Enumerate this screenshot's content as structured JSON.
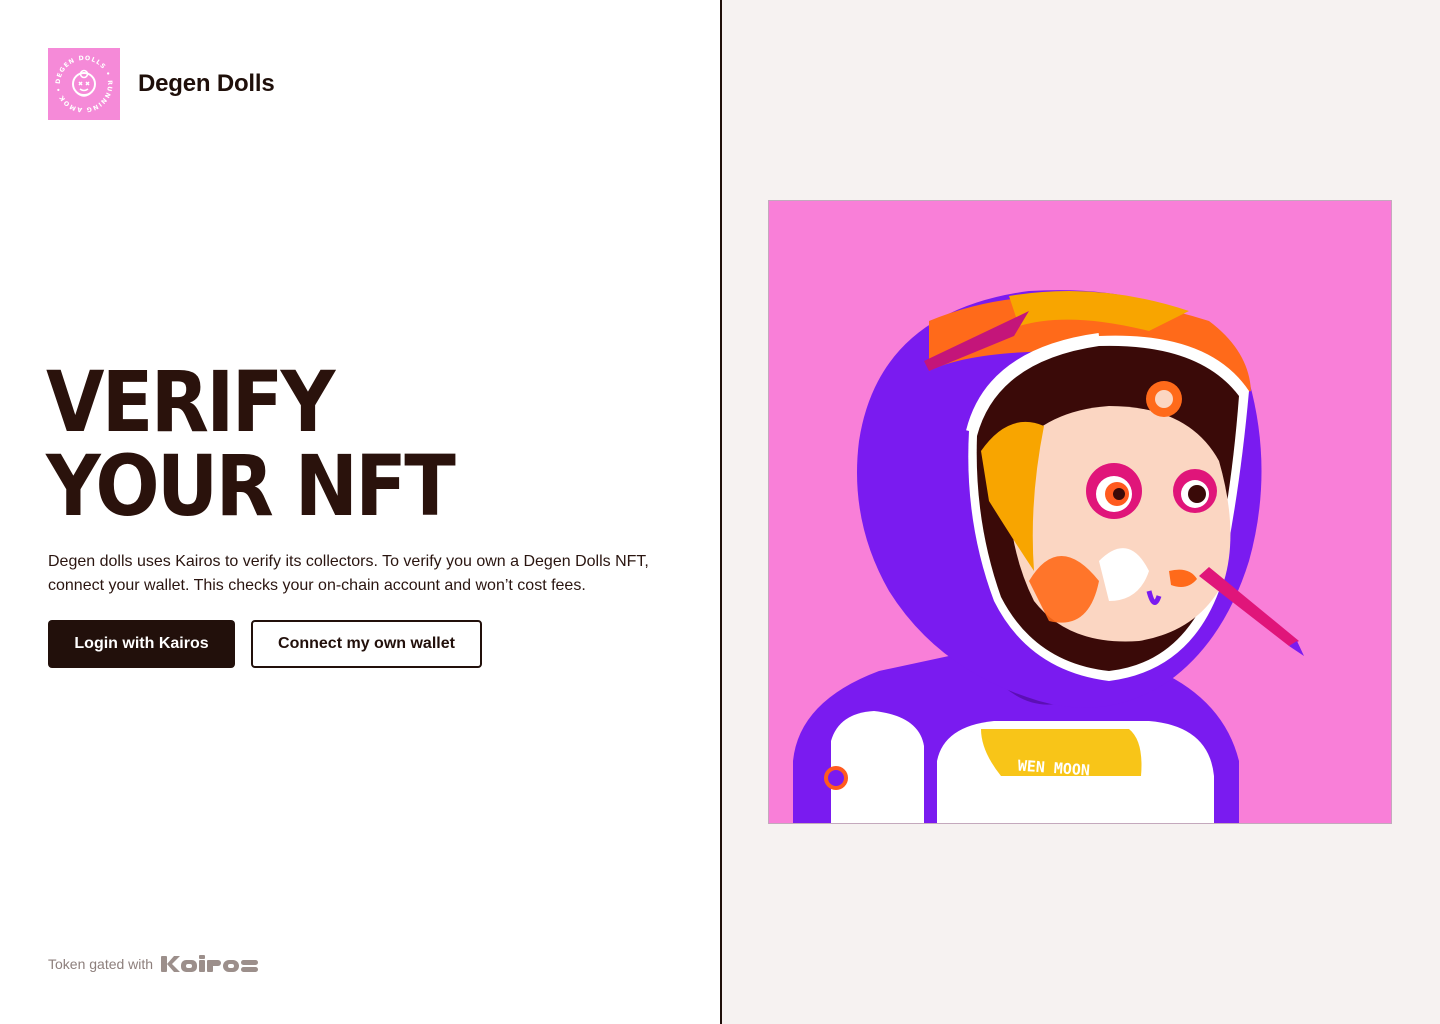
{
  "brand": {
    "name": "Degen Dolls",
    "logo_icon": "degen-dolls-badge",
    "logo_ring_text": "DEGEN DOLLS • RUNNING AMOK •",
    "logo_bg": "#f58ad8"
  },
  "hero": {
    "headline_line1": "VERIFY",
    "headline_line2": "YOUR NFT",
    "description": "Degen dolls uses Kairos to verify its collectors. To verify you own a Degen Dolls NFT, connect your wallet. This checks your on-chain account and won’t cost fees."
  },
  "actions": {
    "primary_label": "Login with Kairos",
    "secondary_label": "Connect my own wallet"
  },
  "footer": {
    "text": "Token gated with",
    "logo_text": "kairos"
  },
  "artwork": {
    "description_icon": "nft-astronaut-doll-illustration",
    "badge_text": "WEN MOON",
    "background": "#f97fd8"
  },
  "colors": {
    "ink": "#1f0f0a",
    "muted": "#8d7f7c",
    "panel": "#f6f2f1",
    "pink": "#f97fd8",
    "purple": "#7a1bf0"
  }
}
